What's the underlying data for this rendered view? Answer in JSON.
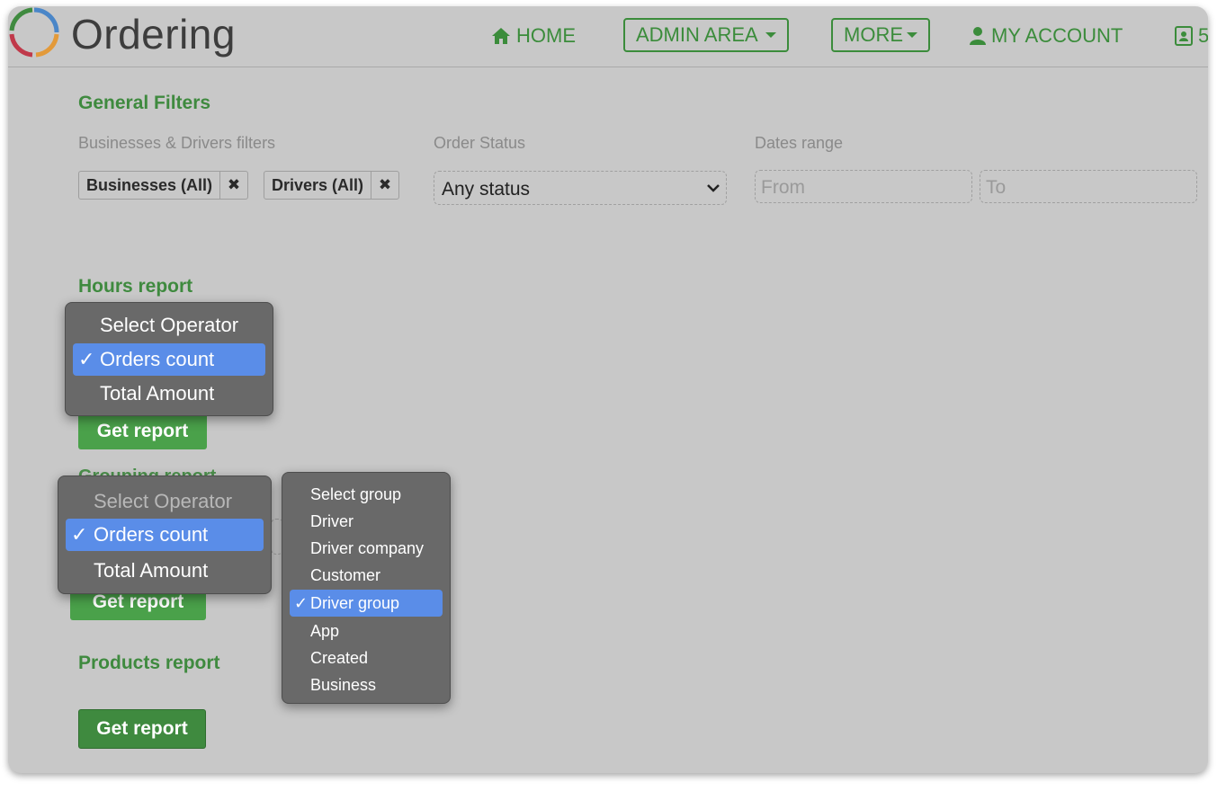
{
  "header": {
    "brand": "Ordering",
    "nav": {
      "home": "HOME",
      "admin_area": "ADMIN AREA",
      "more": "MORE",
      "my_account": "MY ACCOUNT",
      "extra": "5"
    }
  },
  "filters": {
    "title": "General Filters",
    "biz_drivers_label": "Businesses & Drivers filters",
    "chip_businesses": "Businesses (All)",
    "chip_drivers": "Drivers (All)",
    "chip_remove": "✖",
    "order_status_label": "Order Status",
    "order_status_value": "Any status",
    "dates_label": "Dates range",
    "from_placeholder": "From",
    "to_placeholder": "To"
  },
  "hours_report": {
    "title": "Hours report",
    "operator_menu": {
      "items": [
        "Select Operator",
        "Orders count",
        "Total Amount"
      ],
      "selected": "Orders count",
      "check": "✓"
    },
    "get_report": "Get report"
  },
  "grouping_report": {
    "title": "Grouping report",
    "operator_menu": {
      "items": [
        "Select Operator",
        "Orders count",
        "Total Amount"
      ],
      "selected": "Orders count",
      "check": "✓"
    },
    "group_menu": {
      "items": [
        "Select group",
        "Driver",
        "Driver company",
        "Customer",
        "Driver group",
        "App",
        "Created",
        "Business"
      ],
      "selected": "Driver group",
      "check": "✓"
    },
    "get_report": "Get report"
  },
  "products_report": {
    "title": "Products report",
    "get_report": "Get report"
  },
  "colors": {
    "accent_green": "#3f8a3f",
    "button_green": "#4aa14a",
    "menu_bg": "#696969",
    "menu_selected": "#5a8de8",
    "page_bg": "#c8c8c8"
  }
}
